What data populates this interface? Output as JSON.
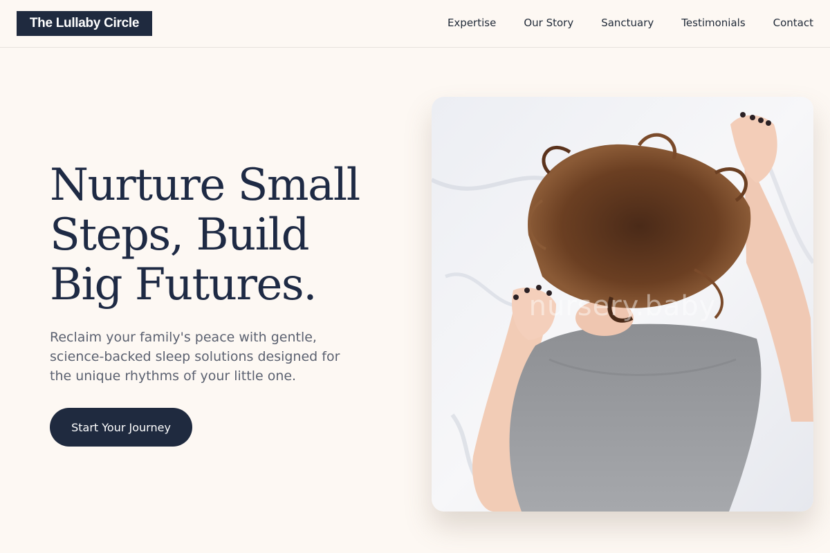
{
  "brand": {
    "name": "The Lullaby Circle"
  },
  "nav": {
    "items": [
      {
        "label": "Expertise"
      },
      {
        "label": "Our Story"
      },
      {
        "label": "Sanctuary"
      },
      {
        "label": "Testimonials"
      },
      {
        "label": "Contact"
      }
    ]
  },
  "hero": {
    "title_lines": [
      "Nurture Small",
      "Steps, Build",
      "Big Futures."
    ],
    "subtitle": "Reclaim your family's peace with gentle, science-backed sleep solutions designed for the unique rhythms of your little one.",
    "cta_label": "Start Your Journey",
    "image": {
      "description": "woman-sleeping-face-down-on-white-sheets",
      "watermark": "nursery.baby"
    }
  },
  "colors": {
    "background": "#fdf8f3",
    "navy": "#1f2a3f",
    "heading": "#1e2a44",
    "body_text": "#5b6170"
  }
}
